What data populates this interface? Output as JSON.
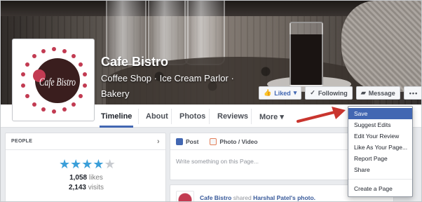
{
  "page": {
    "name": "Cafe Bistro",
    "category_lines": [
      "Coffee Shop · Ice Cream Parlor ·",
      "Bakery"
    ]
  },
  "actions": {
    "liked": "Liked",
    "following": "Following",
    "message": "Message",
    "more": "•••"
  },
  "tabs": [
    "Timeline",
    "About",
    "Photos",
    "Reviews",
    "More ▾"
  ],
  "people": {
    "heading": "PEOPLE",
    "rating_stars": 4,
    "rating_max": 5,
    "likes_count": "1,058",
    "likes_label": "likes",
    "visits_count": "2,143",
    "visits_label": "visits"
  },
  "composer": {
    "post_tab": "Post",
    "photo_tab": "Photo / Video",
    "placeholder": "Write something on this Page..."
  },
  "story": {
    "actor": "Cafe Bistro",
    "middle": "shared",
    "rest": "Harshal Patel's photo."
  },
  "dropdown": {
    "items": [
      "Save",
      "Suggest Edits",
      "Edit Your Review",
      "Like As Your Page...",
      "Report Page",
      "Share"
    ],
    "footer_item": "Create a Page",
    "highlighted_index": 0
  },
  "logo_text": "Cafe Bistro",
  "colors": {
    "accent": "#4267b2",
    "star": "#3b9fd9",
    "arrow": "#c9352e",
    "logo_red": "#c23b52"
  }
}
